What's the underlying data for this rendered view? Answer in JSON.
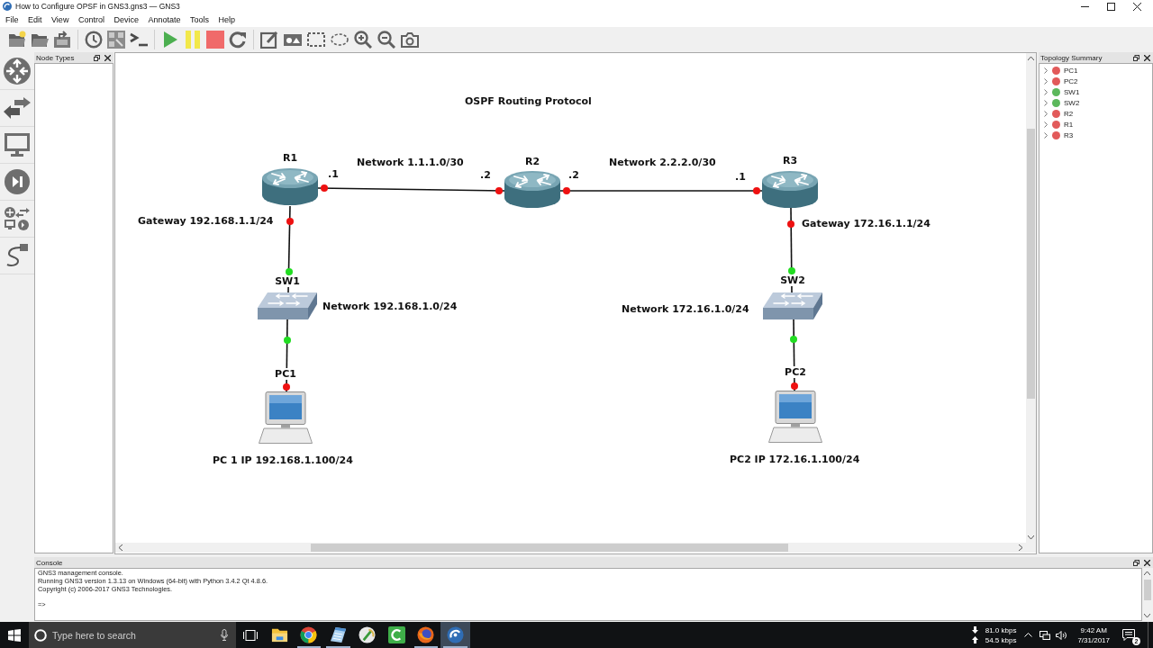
{
  "window": {
    "title": "How to Configure OPSF in GNS3.gns3 — GNS3"
  },
  "menu": [
    "File",
    "Edit",
    "View",
    "Control",
    "Device",
    "Annotate",
    "Tools",
    "Help"
  ],
  "node_types": {
    "title": "Node Types"
  },
  "canvas": {
    "nodes": [
      {
        "name": "R1",
        "kind": "router"
      },
      {
        "name": "R2",
        "kind": "router"
      },
      {
        "name": "R3",
        "kind": "router"
      },
      {
        "name": "SW1",
        "kind": "switch"
      },
      {
        "name": "SW2",
        "kind": "switch"
      },
      {
        "name": "PC1",
        "kind": "pc"
      },
      {
        "name": "PC2",
        "kind": "pc"
      }
    ],
    "links": [
      {
        "ends": [
          {
            "color": "#ee1111"
          },
          {
            "color": "#ee1111"
          }
        ]
      },
      {
        "ends": [
          {
            "color": "#ee1111"
          },
          {
            "color": "#ee1111"
          }
        ]
      },
      {
        "ends": [
          {
            "color": "#ee1111"
          },
          {
            "color": "#22dd22"
          }
        ]
      },
      {
        "ends": [
          {
            "color": "#22dd22"
          },
          {
            "color": "#ee1111"
          }
        ]
      },
      {
        "ends": [
          {
            "color": "#ee1111"
          },
          {
            "color": "#22dd22"
          }
        ]
      },
      {
        "ends": [
          {
            "color": "#22dd22"
          },
          {
            "color": "#ee1111"
          }
        ]
      }
    ],
    "annotations": [
      "OSPF Routing Protocol",
      "Network 1.1.1.0/30",
      "Network 2.2.2.0/30",
      ".1",
      ".2",
      ".2",
      ".1",
      "Gateway 192.168.1.1/24",
      "Gateway 172.16.1.1/24",
      "Network 192.168.1.0/24",
      "Network 172.16.1.0/24",
      "PC 1 IP 192.168.1.100/24",
      "PC2 IP 172.16.1.100/24"
    ]
  },
  "topology_summary": {
    "title": "Topology Summary",
    "items": [
      {
        "name": "PC1",
        "expanded": false,
        "color": "#e25a5a"
      },
      {
        "name": "PC2",
        "expanded": false,
        "color": "#e25a5a"
      },
      {
        "name": "SW1",
        "expanded": false,
        "color": "#5cb85c"
      },
      {
        "name": "SW2",
        "expanded": false,
        "color": "#5cb85c"
      },
      {
        "name": "R2",
        "expanded": false,
        "color": "#e25a5a"
      },
      {
        "name": "R1",
        "expanded": false,
        "color": "#e25a5a"
      },
      {
        "name": "R3",
        "expanded": false,
        "color": "#e25a5a"
      }
    ]
  },
  "console": {
    "title": "Console",
    "lines": [
      "GNS3 management console.",
      "Running GNS3 version 1.3.13 on Windows (64-bit) with Python 3.4.2 Qt 4.8.6.",
      "Copyright (c) 2006-2017 GNS3 Technologies."
    ],
    "prompt": "=>"
  },
  "taskbar": {
    "search": {
      "placeholder": "Type here to search"
    },
    "apps": [
      {
        "running": false,
        "active": false
      },
      {
        "running": true,
        "active": false
      },
      {
        "running": true,
        "active": false
      },
      {
        "running": false,
        "active": false
      },
      {
        "running": false,
        "active": false
      },
      {
        "running": true,
        "active": false
      },
      {
        "running": true,
        "active": true
      }
    ],
    "download_rate": "81.0 kbps",
    "upload_rate": "54.5 kbps",
    "time": "9:42 AM",
    "date": "7/31/2017",
    "notification_count": "2"
  }
}
